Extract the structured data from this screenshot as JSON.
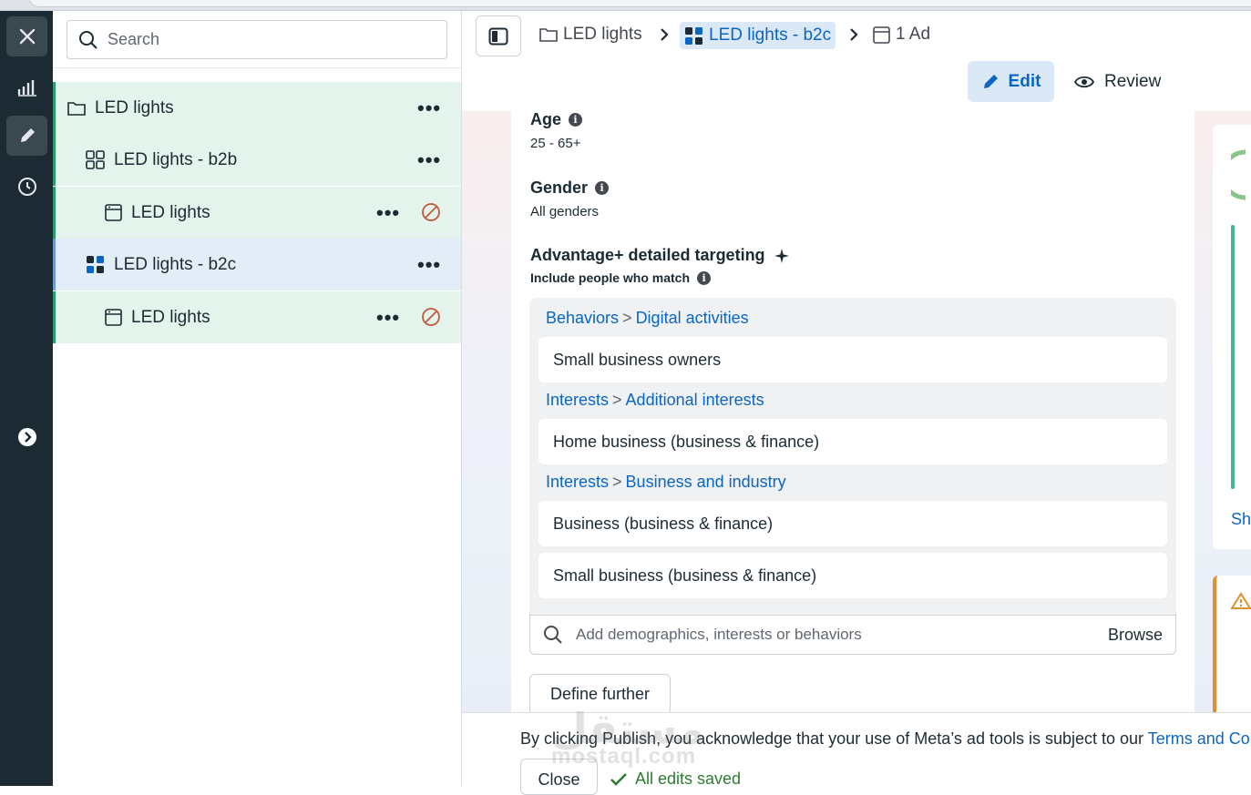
{
  "sidebar": {
    "search_placeholder": "Search",
    "tree": [
      {
        "label": "LED lights"
      },
      {
        "label": "LED lights - b2b"
      },
      {
        "label": "LED lights"
      },
      {
        "label": "LED lights - b2c"
      },
      {
        "label": "LED lights"
      }
    ],
    "more_label": "•••"
  },
  "header": {
    "breadcrumb": [
      {
        "label": "LED lights"
      },
      {
        "label": "LED lights - b2c"
      },
      {
        "label": "1 Ad"
      }
    ],
    "edit_label": "Edit",
    "review_label": "Review"
  },
  "audience": {
    "age_title": "Age",
    "age_value": "25 - 65+",
    "gender_title": "Gender",
    "gender_value": "All genders",
    "targeting_title": "Advantage+ detailed targeting",
    "include_label": "Include people who match",
    "groups": [
      {
        "category": "Behaviors",
        "subcategory": "Digital activities",
        "items": [
          "Small business owners"
        ]
      },
      {
        "category": "Interests",
        "subcategory": "Additional interests",
        "items": [
          "Home business (business & finance)"
        ]
      },
      {
        "category": "Interests",
        "subcategory": "Business and industry",
        "items": [
          "Business (business & finance)",
          "Small business (business & finance)"
        ]
      }
    ],
    "search_placeholder": "Add demographics, interests or behaviors",
    "browse_label": "Browse",
    "define_label": "Define further"
  },
  "right_panel": {
    "link_fragment": "Sh"
  },
  "footer": {
    "notice": "By clicking Publish, you acknowledge that your use of Meta’s ad tools is subject to our ",
    "terms_link": "Terms and Cor",
    "close_label": "Close",
    "saved_label": "All edits saved"
  },
  "watermark": {
    "text": "مستقل",
    "domain": "mostaql.com"
  },
  "colors": {
    "rail": "#1c2b33",
    "accent": "#0a66c2",
    "selected_green": "#e5f3ed",
    "selected_blue": "#e3edf7",
    "warning": "#e1902e"
  }
}
